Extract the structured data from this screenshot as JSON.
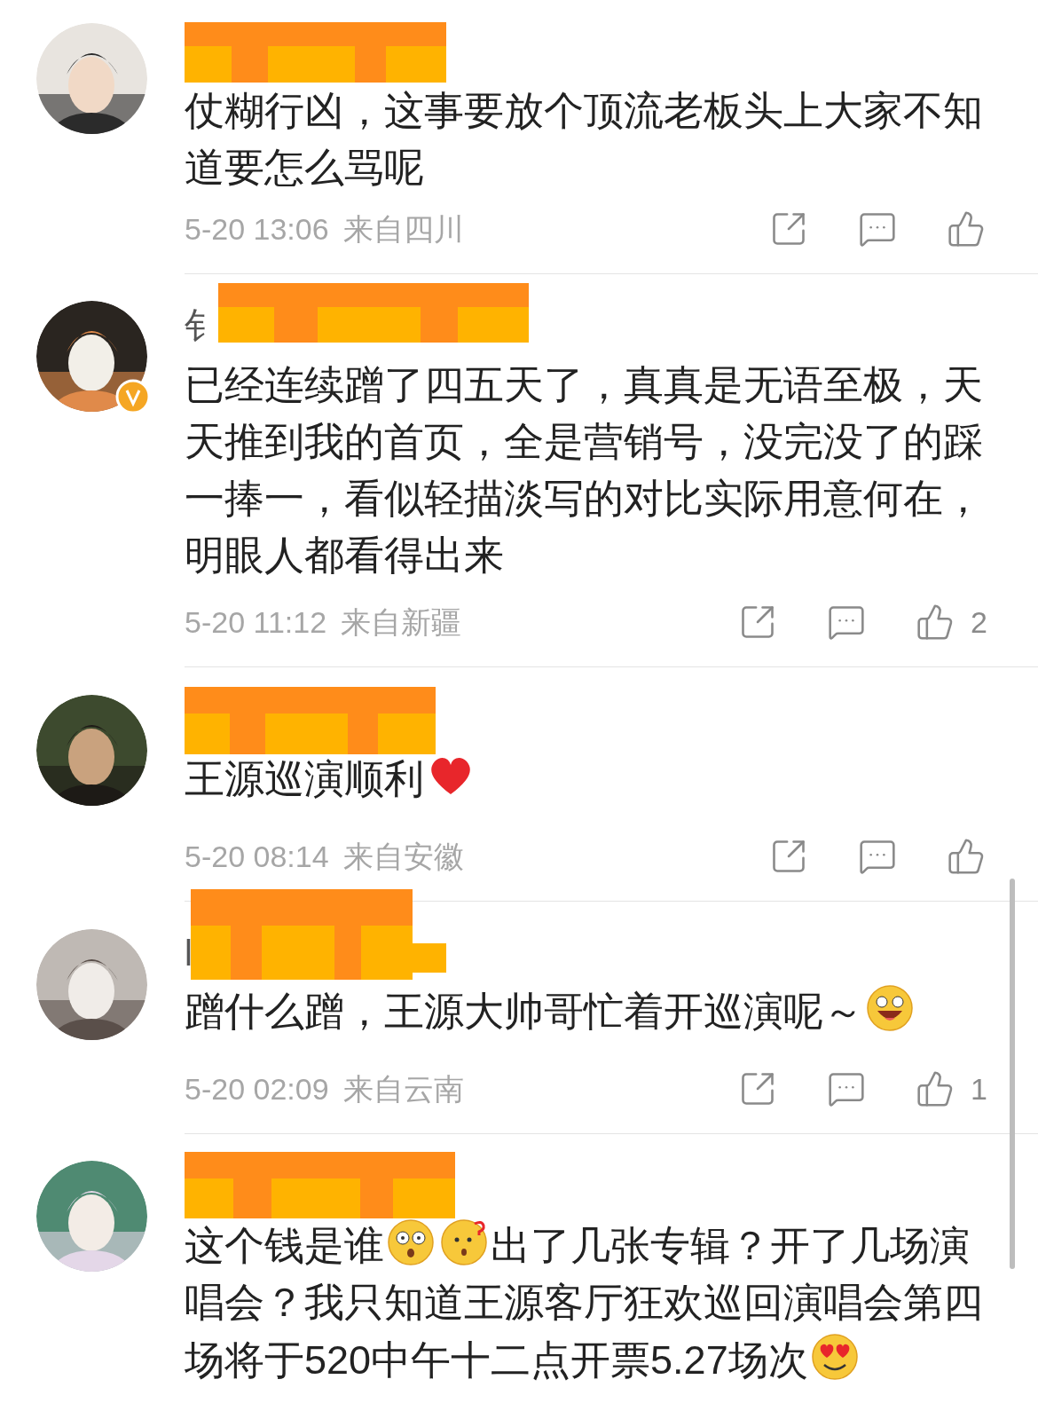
{
  "comments": [
    {
      "body": [
        {
          "kind": "text",
          "text": "仗糊行凶，这事要放个顶流老板头上大家不知道要怎么骂呢"
        }
      ],
      "time": "5-20 13:06",
      "location": "来自四川"
    },
    {
      "name_visible": "钅",
      "body": [
        {
          "kind": "text",
          "text": "已经连续蹭了四五天了，真真是无语至极，天天推到我的首页，全是营销号，没完没了的踩一捧一，看似轻描淡写的对比实际用意何在，明眼人都看得出来"
        }
      ],
      "time": "5-20 11:12",
      "location": "来自新疆",
      "likes": "2",
      "verified": true
    },
    {
      "body": [
        {
          "kind": "text",
          "text": "王源巡演顺利"
        },
        {
          "kind": "heart"
        }
      ],
      "time": "5-20 08:14",
      "location": "来自安徽"
    },
    {
      "name_visible": "l",
      "body": [
        {
          "kind": "text",
          "text": "蹭什么蹭，王源大帅哥忙着开巡演呢～"
        },
        {
          "kind": "laugh"
        }
      ],
      "time": "5-20 02:09",
      "location": "来自云南",
      "likes": "1"
    },
    {
      "body": [
        {
          "kind": "text",
          "text": "这个钱是谁"
        },
        {
          "kind": "shocked"
        },
        {
          "kind": "puzzled"
        },
        {
          "kind": "text",
          "text": "出了几张专辑？开了几场演唱会？我只知道王源客厅狂欢巡回演唱会第四场将于520中午十二点开票5.27场次"
        },
        {
          "kind": "hearteyes"
        }
      ]
    }
  ]
}
